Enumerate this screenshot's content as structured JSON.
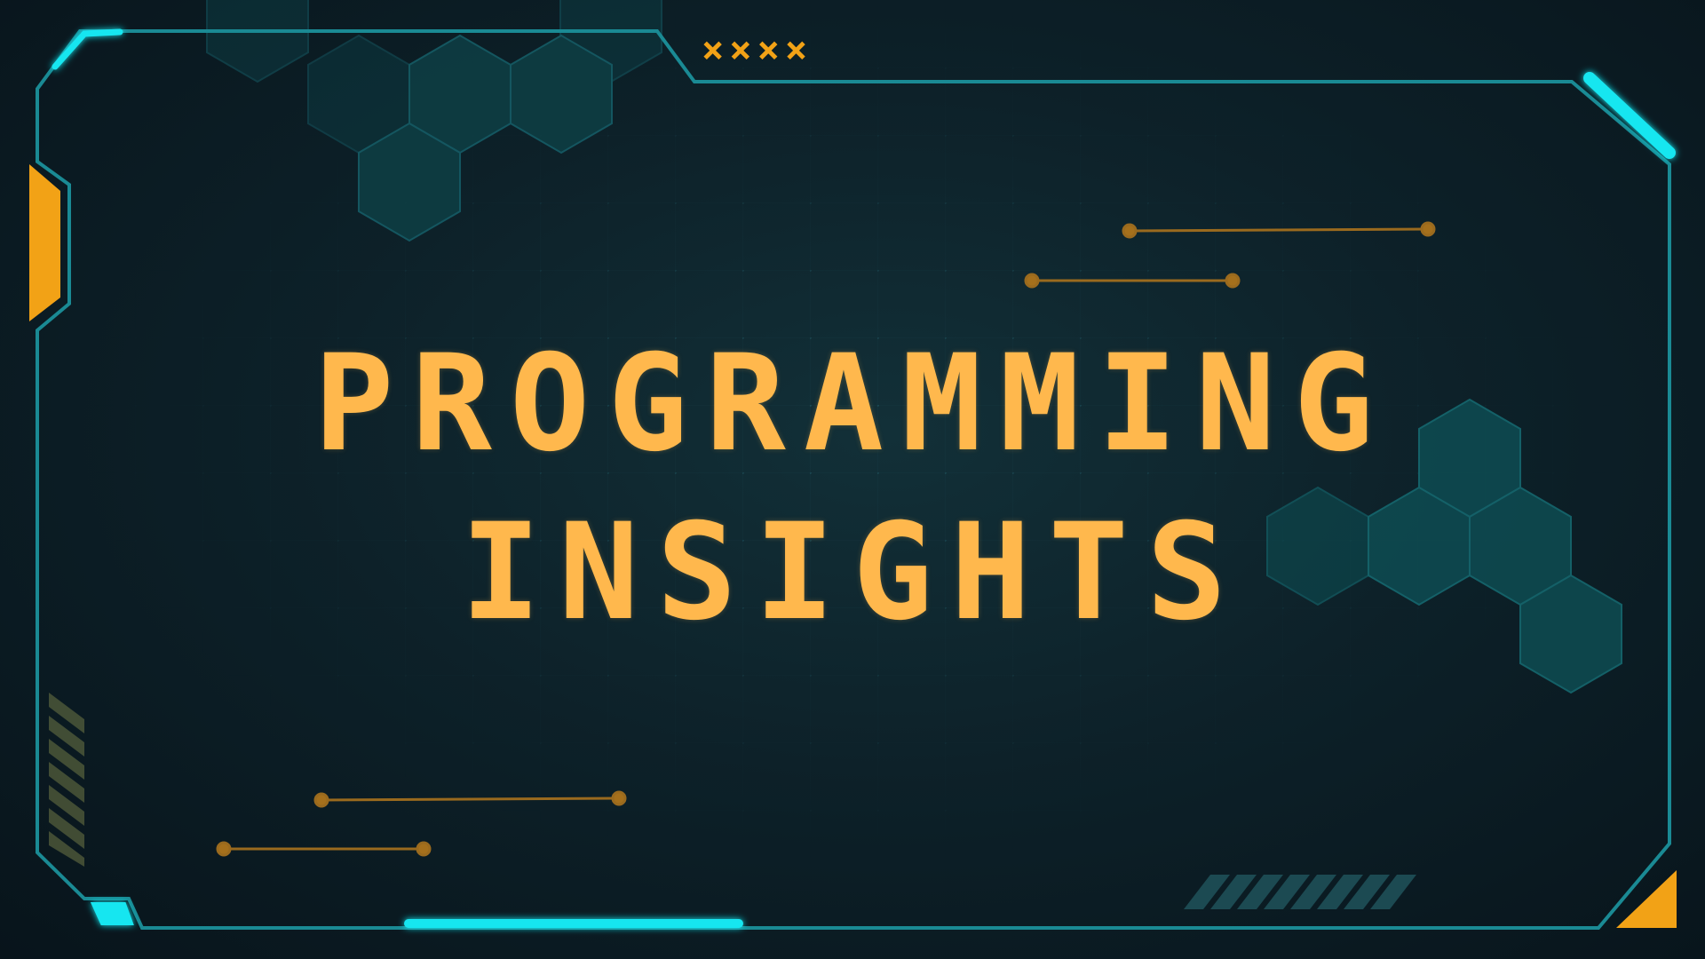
{
  "title": {
    "line1": "PROGRAMMING",
    "line2": "INSIGHTS"
  },
  "badge": "××××",
  "colors": {
    "title": "#ffb84d",
    "accent_cyan": "#19e6f0",
    "accent_orange": "#f2a216",
    "frame": "#1a8a94",
    "hex_fill": "#0e4a50",
    "background": "#0d2129"
  },
  "decorations": {
    "frame": "angled-hud-frame",
    "hexagons": "hex-cluster",
    "connectors": "dot-line-connectors",
    "stripes": "diagonal-hazard-stripes"
  }
}
